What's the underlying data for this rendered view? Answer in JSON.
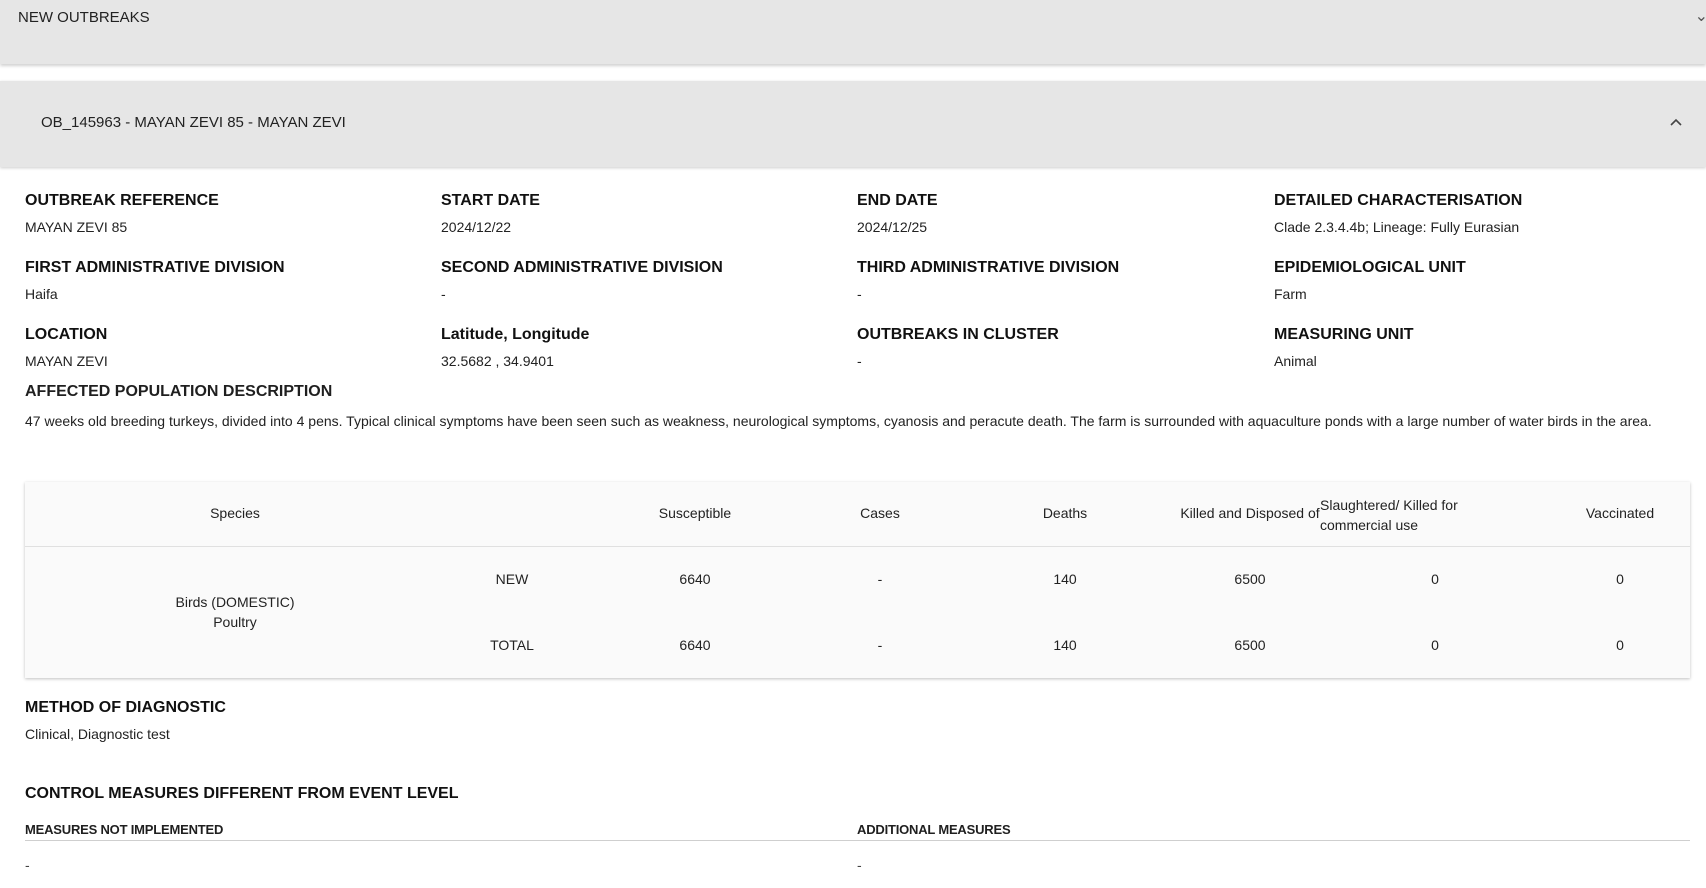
{
  "new_outbreaks": {
    "title": "NEW OUTBREAKS",
    "chevron_icon": "chevron-icon"
  },
  "outbreak": {
    "title": "OB_145963 - MAYAN ZEVI 85 - MAYAN ZEVI",
    "toggle_icon": "chevron-up-icon",
    "fields": {
      "outbreak_reference": {
        "label": "OUTBREAK REFERENCE",
        "value": "MAYAN ZEVI 85"
      },
      "start_date": {
        "label": "START DATE",
        "value": "2024/12/22"
      },
      "end_date": {
        "label": "END DATE",
        "value": "2024/12/25"
      },
      "detailed_characterisation": {
        "label": "DETAILED CHARACTERISATION",
        "value": "Clade 2.3.4.4b; Lineage: Fully Eurasian"
      },
      "first_admin_division": {
        "label": "FIRST ADMINISTRATIVE DIVISION",
        "value": "Haifa"
      },
      "second_admin_division": {
        "label": "SECOND ADMINISTRATIVE DIVISION",
        "value": "-"
      },
      "third_admin_division": {
        "label": "THIRD ADMINISTRATIVE DIVISION",
        "value": "-"
      },
      "epidemiological_unit": {
        "label": "EPIDEMIOLOGICAL UNIT",
        "value": "Farm"
      },
      "location": {
        "label": "LOCATION",
        "value": "MAYAN ZEVI"
      },
      "lat_long": {
        "label": "Latitude, Longitude",
        "value": "32.5682 , 34.9401"
      },
      "outbreaks_in_cluster": {
        "label": "OUTBREAKS IN CLUSTER",
        "value": "-"
      },
      "measuring_unit": {
        "label": "MEASURING UNIT",
        "value": "Animal"
      }
    },
    "affected_population": {
      "label": "AFFECTED POPULATION DESCRIPTION",
      "text": "47 weeks old breeding turkeys, divided into 4 pens. Typical clinical symptoms have been seen such as weakness, neurological symptoms, cyanosis and peracute death. The farm is surrounded with aquaculture ponds with a large number of water birds in the area."
    },
    "table": {
      "headers": {
        "species": "Species",
        "susceptible": "Susceptible",
        "cases": "Cases",
        "deaths": "Deaths",
        "killed": "Killed and Disposed of",
        "slaughtered": "Slaughtered/ Killed for commercial use",
        "vaccinated": "Vaccinated"
      },
      "species_line1": "Birds (DOMESTIC)",
      "species_line2": "Poultry",
      "rows": [
        {
          "kind": "NEW",
          "susceptible": "6640",
          "cases": "-",
          "deaths": "140",
          "killed": "6500",
          "slaughtered": "0",
          "vaccinated": "0"
        },
        {
          "kind": "TOTAL",
          "susceptible": "6640",
          "cases": "-",
          "deaths": "140",
          "killed": "6500",
          "slaughtered": "0",
          "vaccinated": "0"
        }
      ]
    },
    "method_of_diagnostic": {
      "label": "METHOD OF DIAGNOSTIC",
      "value": "Clinical, Diagnostic test"
    },
    "control_measures": {
      "label": "CONTROL MEASURES DIFFERENT FROM EVENT LEVEL",
      "not_implemented_label": "MEASURES NOT IMPLEMENTED",
      "not_implemented_value": "-",
      "additional_label": "ADDITIONAL MEASURES",
      "additional_value": "-"
    }
  }
}
